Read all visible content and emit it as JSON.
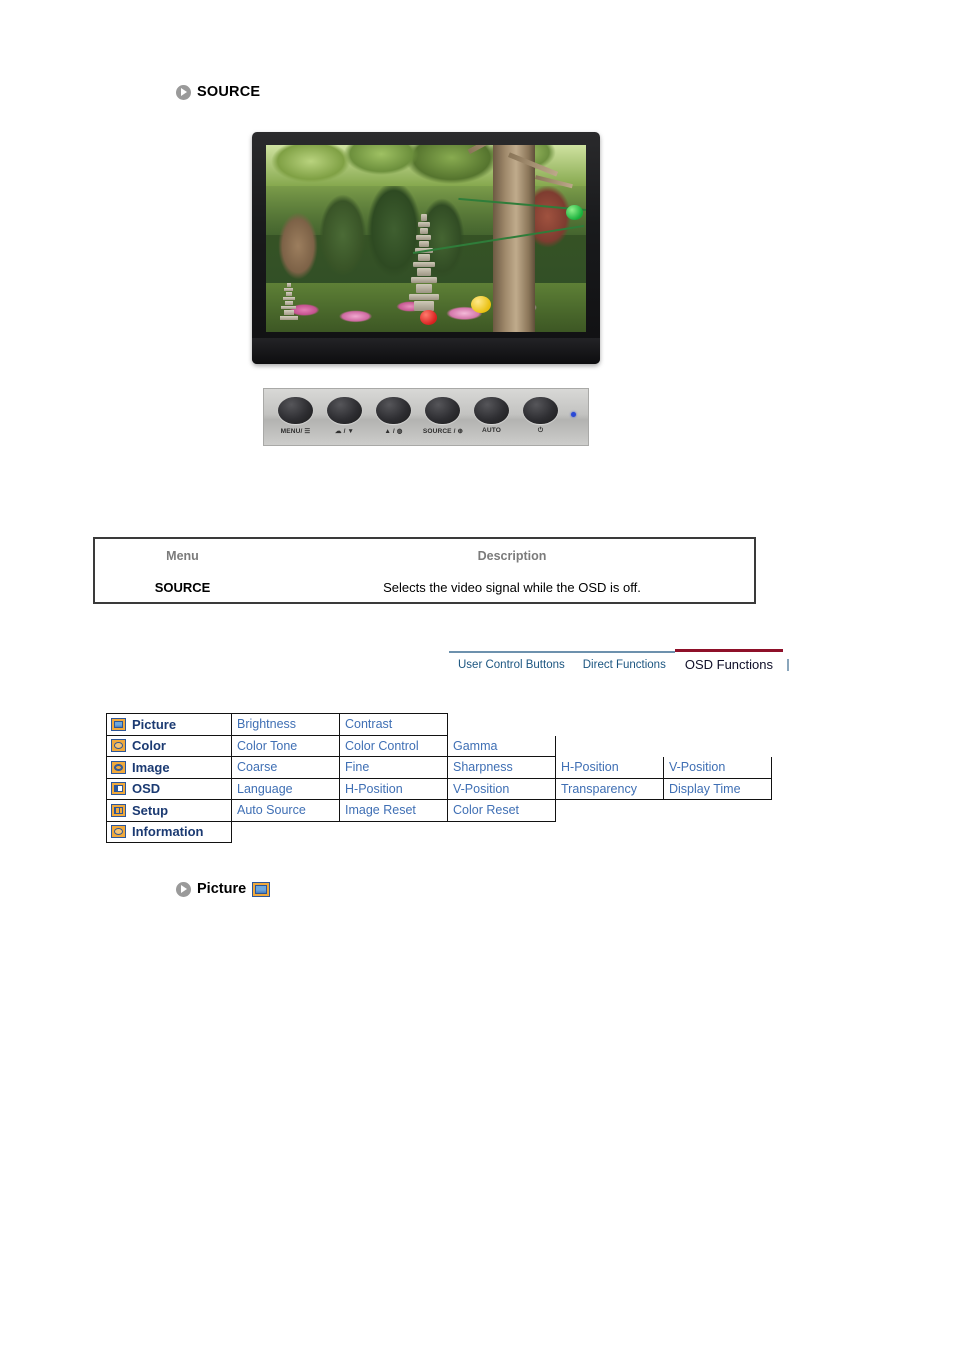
{
  "source_section": {
    "bullet_icon": "arrow-circle-icon",
    "title": "SOURCE"
  },
  "monitor": {
    "screen_image_alt": "Korean garden with stone pagoda, trees and paper lanterns",
    "panel": {
      "buttons": [
        {
          "icon": "menu-button",
          "label": "MENU/ ☰"
        },
        {
          "icon": "down-button",
          "label": "☁ / ▼"
        },
        {
          "icon": "up-button",
          "label": "▲ / ◍"
        },
        {
          "icon": "source-button",
          "label": "SOURCE / ⊕"
        },
        {
          "icon": "auto-button",
          "label": "AUTO"
        },
        {
          "icon": "power-button",
          "label": "⏻"
        }
      ],
      "led_color": "#2a49d6"
    }
  },
  "description_table": {
    "headers": [
      "Menu",
      "Description"
    ],
    "rows": [
      {
        "menu": "SOURCE",
        "description": "Selects the video signal while the OSD is off."
      }
    ]
  },
  "tabs": {
    "items": [
      {
        "label": "User Control Buttons",
        "active": false
      },
      {
        "label": "Direct Functions",
        "active": false
      },
      {
        "label": "OSD Functions",
        "active": true
      }
    ],
    "active_color": "#8e1029",
    "inactive_color": "#1b5580"
  },
  "osd_table": {
    "categories": [
      {
        "icon": "picture-icon",
        "label": "Picture",
        "items": [
          "Brightness",
          "Contrast"
        ]
      },
      {
        "icon": "color-icon",
        "label": "Color",
        "items": [
          "Color Tone",
          "Color Control",
          "Gamma"
        ]
      },
      {
        "icon": "image-icon",
        "label": "Image",
        "items": [
          "Coarse",
          "Fine",
          "Sharpness",
          "H-Position",
          "V-Position"
        ]
      },
      {
        "icon": "osd-icon",
        "label": "OSD",
        "items": [
          "Language",
          "H-Position",
          "V-Position",
          "Transparency",
          "Display Time"
        ]
      },
      {
        "icon": "setup-icon",
        "label": "Setup",
        "items": [
          "Auto Source",
          "Image Reset",
          "Color Reset"
        ]
      },
      {
        "icon": "information-icon",
        "label": "Information",
        "items": []
      }
    ],
    "category_color": "#1b3a72",
    "item_color": "#3f6fb4"
  },
  "picture_section": {
    "bullet_icon": "arrow-circle-icon",
    "title": "Picture",
    "icon": "picture-icon"
  }
}
